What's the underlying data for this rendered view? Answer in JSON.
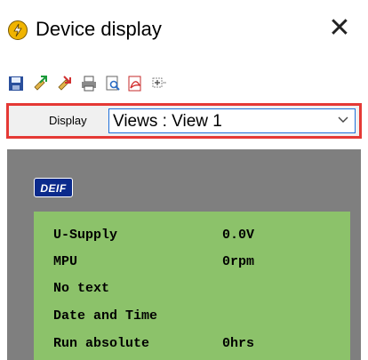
{
  "window": {
    "title": "Device display"
  },
  "toolbar": {
    "icons": [
      "save-icon",
      "upload-config-icon",
      "download-config-icon",
      "print-icon",
      "print-preview-icon",
      "pdf-export-icon",
      "zoom-fit-icon"
    ]
  },
  "display": {
    "label": "Display",
    "selected": "Views : View 1"
  },
  "colors": {
    "accent_border": "#e53935",
    "screen_bg": "#8cc26a",
    "panel_bg": "#7f7f7f"
  },
  "brand": {
    "logo_text": "DEIF"
  },
  "screen": {
    "rows": [
      {
        "label": "U-Supply",
        "value": "0.0V"
      },
      {
        "label": "MPU",
        "value": "0rpm"
      },
      {
        "label": "No text",
        "value": ""
      },
      {
        "label": "Date and Time",
        "value": ""
      },
      {
        "label": "Run absolute",
        "value": "0hrs"
      }
    ]
  }
}
